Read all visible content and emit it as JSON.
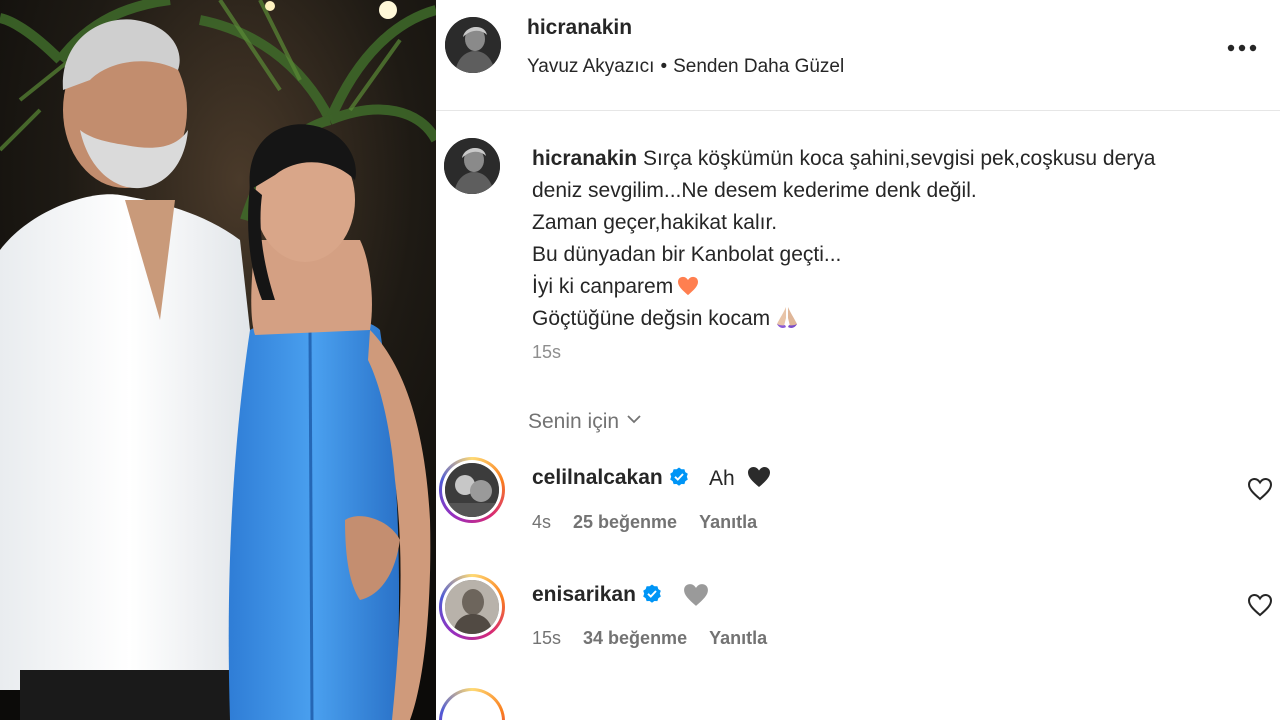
{
  "post": {
    "username": "hicranakin",
    "music_artist": "Yavuz Akyazıcı",
    "music_separator": "•",
    "music_title": "Senden Daha Güzel",
    "more_label": "•••"
  },
  "caption": {
    "username": "hicranakin",
    "lines": [
      "Sırça köşkümün koca şahini,sevgisi pek,coşkusu derya",
      "deniz sevgilim...Ne desem kederime denk değil.",
      "Zaman geçer,hakikat kalır.",
      "Bu dünyadan bir Kanbolat geçti...",
      "İyi ki canparem",
      "Göçtüğüne değsin kocam"
    ],
    "time": "15s"
  },
  "filter": {
    "label": "Senin için"
  },
  "comments": [
    {
      "username": "celilnalcakan",
      "verified": true,
      "text": "Ah",
      "emoji": "black-heart",
      "time": "4s",
      "likes": "25 beğenme",
      "reply": "Yanıtla"
    },
    {
      "username": "enisarikan",
      "verified": true,
      "text": "",
      "emoji": "grey-heart",
      "time": "15s",
      "likes": "34 beğenme",
      "reply": "Yanıtla"
    }
  ],
  "colors": {
    "verified_blue": "#0095f6",
    "muted_text": "#737373",
    "story_ring": [
      "#feda75",
      "#fa7e1e",
      "#d62976",
      "#962fbf",
      "#4f5bd5"
    ],
    "dress_blue": "#3d8fe0"
  }
}
